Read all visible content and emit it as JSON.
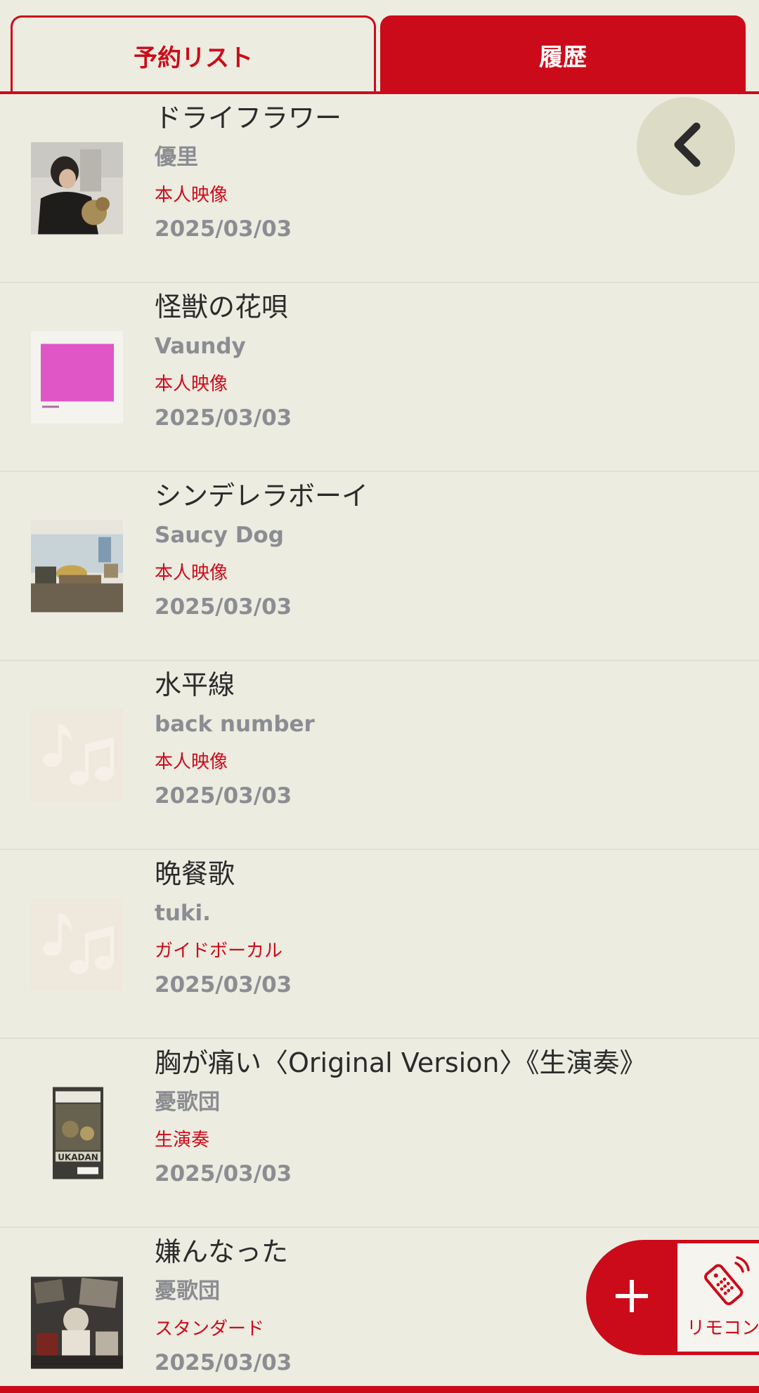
{
  "tabs": {
    "reserve_label": "予約リスト",
    "history_label": "履歴",
    "active": "history"
  },
  "history": [
    {
      "title": "ドライフラワー",
      "artist": "優里",
      "type": "本人映像",
      "date": "2025/03/03",
      "thumb": "photo-portrait"
    },
    {
      "title": "怪獣の花唄",
      "artist": "Vaundy",
      "type": "本人映像",
      "date": "2025/03/03",
      "thumb": "magenta-cover"
    },
    {
      "title": "シンデレラボーイ",
      "artist": "Saucy Dog",
      "type": "本人映像",
      "date": "2025/03/03",
      "thumb": "room-photo"
    },
    {
      "title": "水平線",
      "artist": "back number",
      "type": "本人映像",
      "date": "2025/03/03",
      "thumb": "music-note-placeholder"
    },
    {
      "title": "晩餐歌",
      "artist": "tuki.",
      "type": "ガイドボーカル",
      "date": "2025/03/03",
      "thumb": "music-note-placeholder"
    },
    {
      "title": "胸が痛い〈Original Version〉《生演奏》",
      "artist": "憂歌団",
      "type": "生演奏",
      "date": "2025/03/03",
      "thumb": "cassette-cover"
    },
    {
      "title": "嫌んなった",
      "artist": "憂歌団",
      "type": "スタンダード",
      "date": "2025/03/03",
      "thumb": "collage-cover"
    }
  ],
  "fab": {
    "add_icon": "plus-icon",
    "remote_icon": "remote-control-icon",
    "remote_label": "リモコン"
  },
  "back_icon": "chevron-left-icon",
  "colors": {
    "accent": "#cc0b1a",
    "background": "#ecece1",
    "muted_text": "#8b8d92",
    "back_button_bg": "#dcdbc6"
  }
}
